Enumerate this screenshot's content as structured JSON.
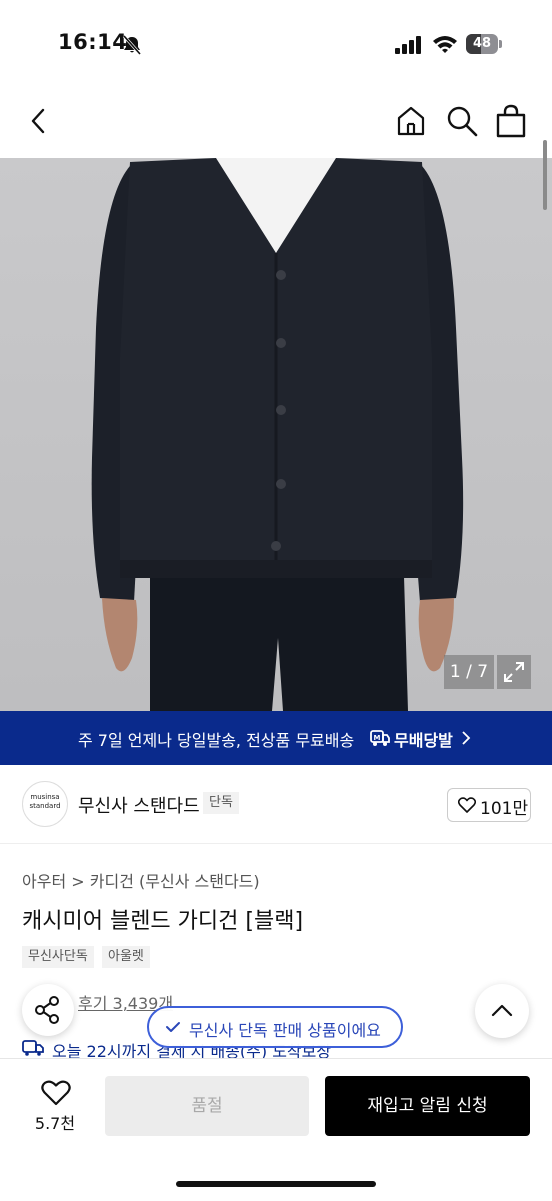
{
  "status_bar": {
    "time": "16:14",
    "battery": "48",
    "battery_level": 0.48,
    "icons": [
      "bell-slash-icon",
      "signal-icon",
      "wifi-icon",
      "battery-icon"
    ]
  },
  "nav": {
    "icons": [
      "chevron-left-icon",
      "home-icon",
      "search-icon",
      "shopping-bag-icon"
    ]
  },
  "gallery": {
    "counter": "1 / 7",
    "current": 1,
    "total": 7
  },
  "banner": {
    "text": "주 7일 언제나 당일발송, 전상품 무료배송",
    "link": "무배당발",
    "color": "#0a2a8c"
  },
  "brand": {
    "logo_line1": "musinsa",
    "logo_line2": "standard",
    "name": "무신사 스탠다드",
    "tag": "단독",
    "likes": "101만"
  },
  "product": {
    "breadcrumb_1": "아우터",
    "breadcrumb_2": "카디건 (무신사 스탠다드)",
    "title": "캐시미어 블렌드 가디건 [블랙]",
    "tags": [
      "무신사단독",
      "아울렛"
    ],
    "reviews": "후기 3,439개",
    "delivery_note": "오늘 22시까지 결제 시 배송(주) 도착보장"
  },
  "toast": {
    "text": "무신사 단독 판매 상품이에요"
  },
  "bottom_bar": {
    "wish_count": "5.7천",
    "soldout_label": "품절",
    "restock_label": "재입고 알림 신청"
  }
}
